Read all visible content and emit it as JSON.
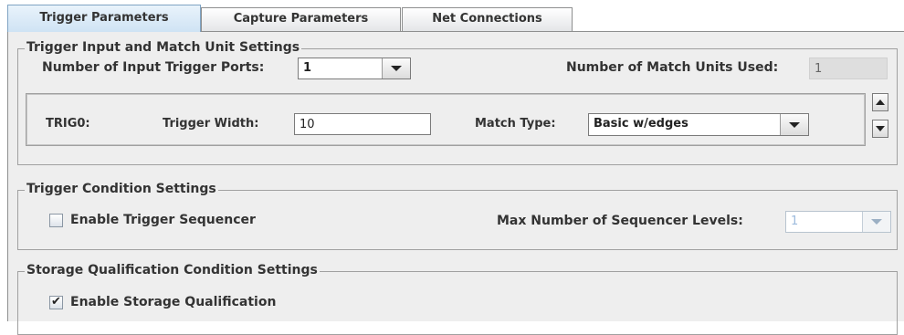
{
  "tabs": [
    {
      "label": "Trigger Parameters",
      "active": true
    },
    {
      "label": "Capture Parameters",
      "active": false
    },
    {
      "label": "Net Connections",
      "active": false
    }
  ],
  "trigger_input": {
    "title": "Trigger Input and Match Unit Settings",
    "ports_label": "Number of Input Trigger Ports:",
    "ports_value": "1",
    "match_units_label": "Number of Match Units Used:",
    "match_units_value": "1",
    "trig_row": {
      "name": "TRIG0:",
      "width_label": "Trigger Width:",
      "width_value": "10",
      "match_type_label": "Match Type:",
      "match_type_value": "Basic w/edges"
    }
  },
  "trigger_condition": {
    "title": "Trigger Condition Settings",
    "enable_sequencer_label": "Enable Trigger Sequencer",
    "enable_sequencer_checked": false,
    "max_levels_label": "Max Number of Sequencer Levels:",
    "max_levels_value": "1"
  },
  "storage": {
    "title": "Storage Qualification Condition Settings",
    "enable_label": "Enable Storage Qualification",
    "enable_checked": true
  },
  "icons": {
    "checkmark": "✔",
    "scroll_up": "scroll-up-icon",
    "scroll_down": "scroll-down-icon",
    "dropdown": "chevron-down-icon"
  },
  "colors": {
    "active_tab": "#cfe3f4",
    "panel_bg": "#eeeeee",
    "disabled_text": "#9dbbdd"
  }
}
